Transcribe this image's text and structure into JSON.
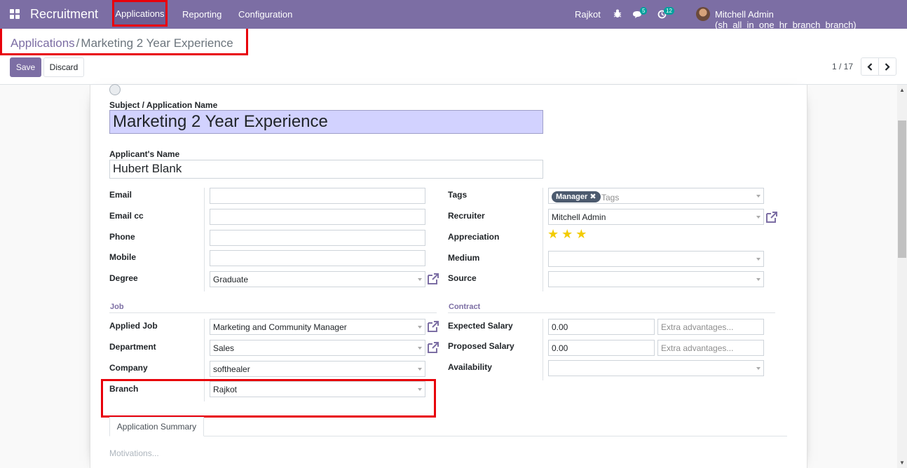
{
  "navbar": {
    "app_title": "Recruitment",
    "menu": [
      "Applications",
      "Reporting",
      "Configuration"
    ],
    "branch": "Rajkot",
    "messages_count": "5",
    "activities_count": "12",
    "user": "Mitchell Admin (sh_all_in_one_hr_branch_branch)",
    "bg_color": "#7c6ea4"
  },
  "breadcrumb": {
    "parent": "Applications",
    "separator": "/",
    "current": "Marketing 2 Year Experience"
  },
  "buttons": {
    "save": "Save",
    "discard": "Discard"
  },
  "pager": {
    "value": "1 / 17",
    "prev_icon": "chevron-left-icon",
    "next_icon": "chevron-right-icon"
  },
  "form": {
    "subject_label": "Subject / Application Name",
    "subject_value": "Marketing 2 Year Experience",
    "applicant_label": "Applicant's Name",
    "applicant_value": "Hubert Blank",
    "left": {
      "email_label": "Email",
      "email_value": "",
      "emailcc_label": "Email cc",
      "emailcc_value": "",
      "phone_label": "Phone",
      "phone_value": "",
      "mobile_label": "Mobile",
      "mobile_value": "",
      "degree_label": "Degree",
      "degree_value": "Graduate"
    },
    "right": {
      "tags_label": "Tags",
      "tag": "Manager",
      "tags_placeholder": "Tags",
      "recruiter_label": "Recruiter",
      "recruiter_value": "Mitchell Admin",
      "appreciation_label": "Appreciation",
      "appreciation_stars": 3,
      "medium_label": "Medium",
      "medium_value": "",
      "source_label": "Source",
      "source_value": ""
    },
    "job": {
      "section_title": "Job",
      "applied_job_label": "Applied Job",
      "applied_job_value": "Marketing and Community Manager",
      "department_label": "Department",
      "department_value": "Sales",
      "company_label": "Company",
      "company_value": "softhealer",
      "branch_label": "Branch",
      "branch_value": "Rajkot"
    },
    "contract": {
      "section_title": "Contract",
      "expected_label": "Expected Salary",
      "expected_value": "0.00",
      "expected_extra_ph": "Extra advantages...",
      "proposed_label": "Proposed Salary",
      "proposed_value": "0.00",
      "proposed_extra_ph": "Extra advantages...",
      "availability_label": "Availability",
      "availability_value": ""
    },
    "tab_label": "Application Summary",
    "motivations_placeholder": "Motivations..."
  }
}
